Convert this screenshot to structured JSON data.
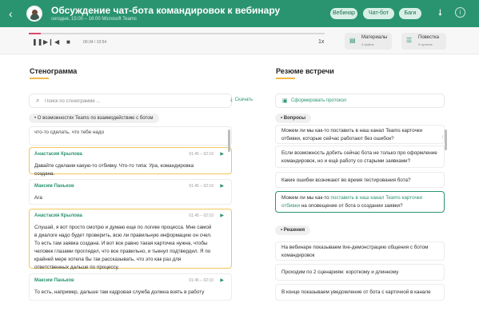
{
  "header": {
    "title": "Обсуждение чат-бота командировок к вебинару",
    "subtitle": "сегодня, 15:00 – 16:00 Microsoft Teams",
    "tags": [
      "Вебинар",
      "Чат-бот",
      "Баги"
    ],
    "icons": {
      "back": "back-arrow-icon",
      "share": "share-icon",
      "info": "info-icon"
    }
  },
  "player": {
    "time": "00:34 / 10:54",
    "speed": "1x",
    "progress": 0.04,
    "materials": {
      "title": "Материалы",
      "subtitle": "3 файла"
    },
    "agenda": {
      "title": "Повестка",
      "subtitle": "5 пунктов"
    }
  },
  "transcript": {
    "title": "Стенограмма",
    "search_placeholder": "Поиск по стенограмме ...",
    "download_label": "Скачать",
    "topic": "О возможностях Teams по взаимодействию с ботом",
    "top_snippet": "что-то сделать, что тебе надо",
    "messages": [
      {
        "name": "Анастасия Крылова",
        "time": "01:45 – 02:10",
        "text": "Давайте сделаем какую-то отбивку. Что-то типа: Ура, командировка создана."
      },
      {
        "name": "Максим Паньков",
        "time": "01:45 – 02:10",
        "text": "Ага"
      },
      {
        "name": "Анастасия Крылова",
        "time": "01:45 – 02:10",
        "text": "Слушай, я вот просто смотрю и думаю еще по логике процесса. Мне самой в диалоге надо будет проверить, всю ли правильную информацию он счел. То есть там заявка создана. И вот все равно такая карточка нужна, чтобы человек глазами проглядел, что все правильно, и тыкнул подтвердил. Я по крайней мере хотела бы так рассказывать, что это как раз для ответственных дальше по процессу."
      },
      {
        "name": "Максим Паньков",
        "time": "01:45 – 02:10",
        "text": "То есть, например, дальше там кадровая служба должна взять в работу"
      }
    ]
  },
  "summary": {
    "title": "Резюме встречи",
    "generate_label": "Сформировать протокол",
    "questions_label": "Вопросы",
    "questions": [
      {
        "text": "Можем ли мы как-то поставить в наш канал Teams карточки отбивки, которые сейчас работают без ошибок?"
      },
      {
        "text": "Если возможность добить сейчас бота не только про оформление командировок, но и ещё работу со старыми заявками?"
      },
      {
        "text": "Какие ошибки возникают во время тестирования бота?"
      },
      {
        "prefix": "Можем ли мы как-то ",
        "link": "поставить в наш канал Teams карточки отбивки",
        "suffix": " на оповещение от бота о создании заявки?"
      }
    ],
    "decisions_label": "Решения",
    "decisions": [
      "На вебинаре показываем live-демонстрацию общения с ботом командировок",
      "Проходим по 2 сценариям: короткому и длинному",
      "В конце показываем уведомление от бота с карточкой в канале"
    ]
  }
}
